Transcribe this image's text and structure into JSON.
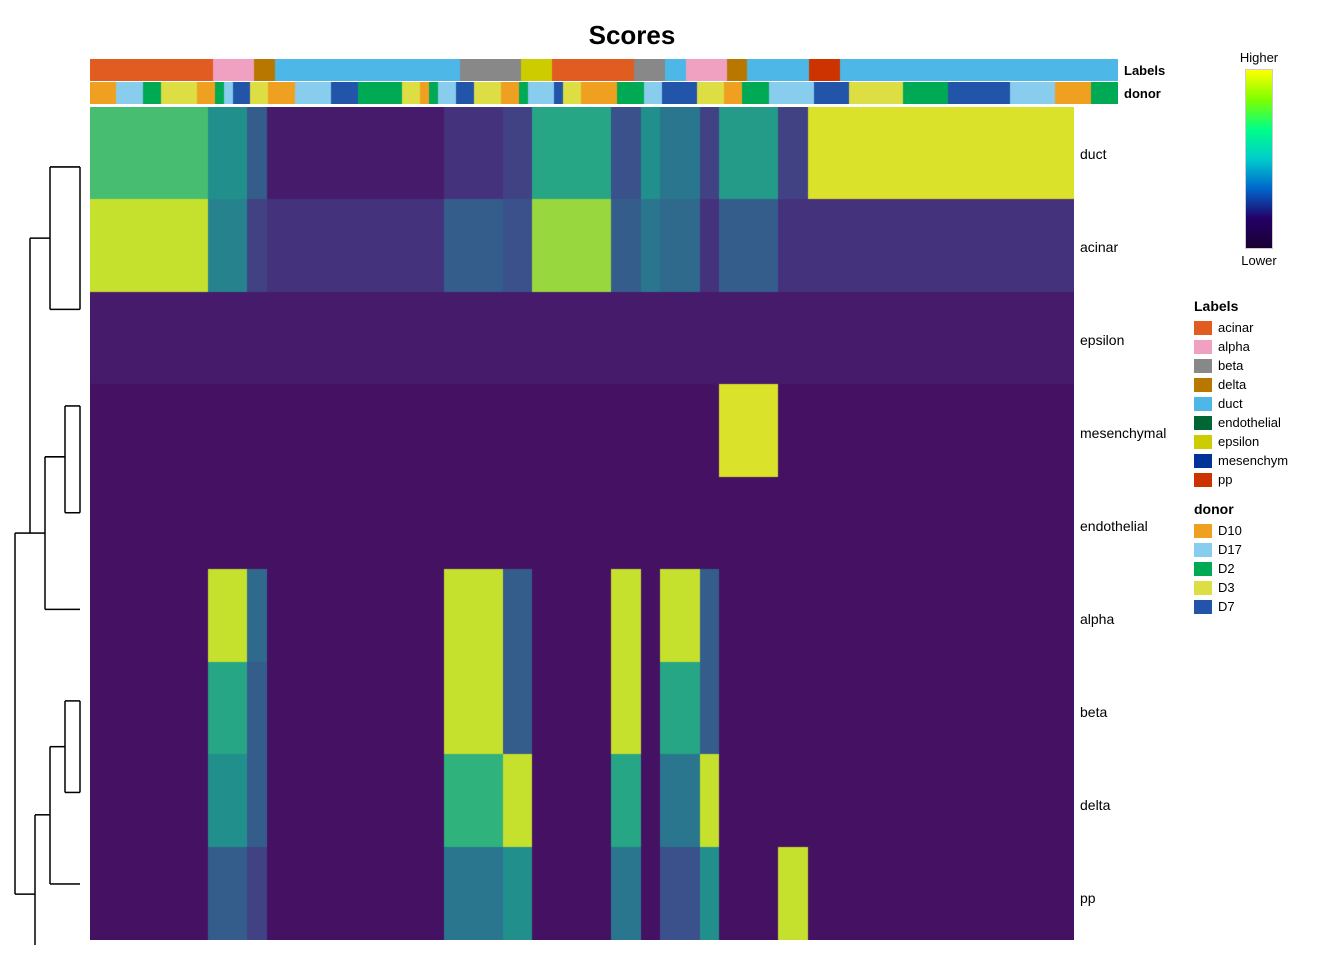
{
  "title": "Scores",
  "colorscale": {
    "high_label": "Higher",
    "low_label": "Lower"
  },
  "labels_legend": {
    "title": "Labels",
    "items": [
      {
        "name": "acinar",
        "color": "#e05c20"
      },
      {
        "name": "alpha",
        "color": "#f0a0c0"
      },
      {
        "name": "beta",
        "color": "#888888"
      },
      {
        "name": "delta",
        "color": "#b87800"
      },
      {
        "name": "duct",
        "color": "#4db8e8"
      },
      {
        "name": "endothelial",
        "color": "#006633"
      },
      {
        "name": "epsilon",
        "color": "#cccc00"
      },
      {
        "name": "mesenchym",
        "color": "#003399"
      },
      {
        "name": "pp",
        "color": "#cc3300"
      }
    ]
  },
  "donor_legend": {
    "title": "donor",
    "items": [
      {
        "name": "D10",
        "color": "#f0a020"
      },
      {
        "name": "D17",
        "color": "#88ccee"
      },
      {
        "name": "D2",
        "color": "#00aa55"
      },
      {
        "name": "D3",
        "color": "#dddd44"
      },
      {
        "name": "D7",
        "color": "#2255aa"
      }
    ]
  },
  "row_labels": [
    "duct",
    "acinar",
    "epsilon",
    "mesenchymal",
    "endothelial",
    "alpha",
    "beta",
    "delta",
    "pp"
  ],
  "annotation_labels_label": "Labels",
  "annotation_donor_label": "donor"
}
